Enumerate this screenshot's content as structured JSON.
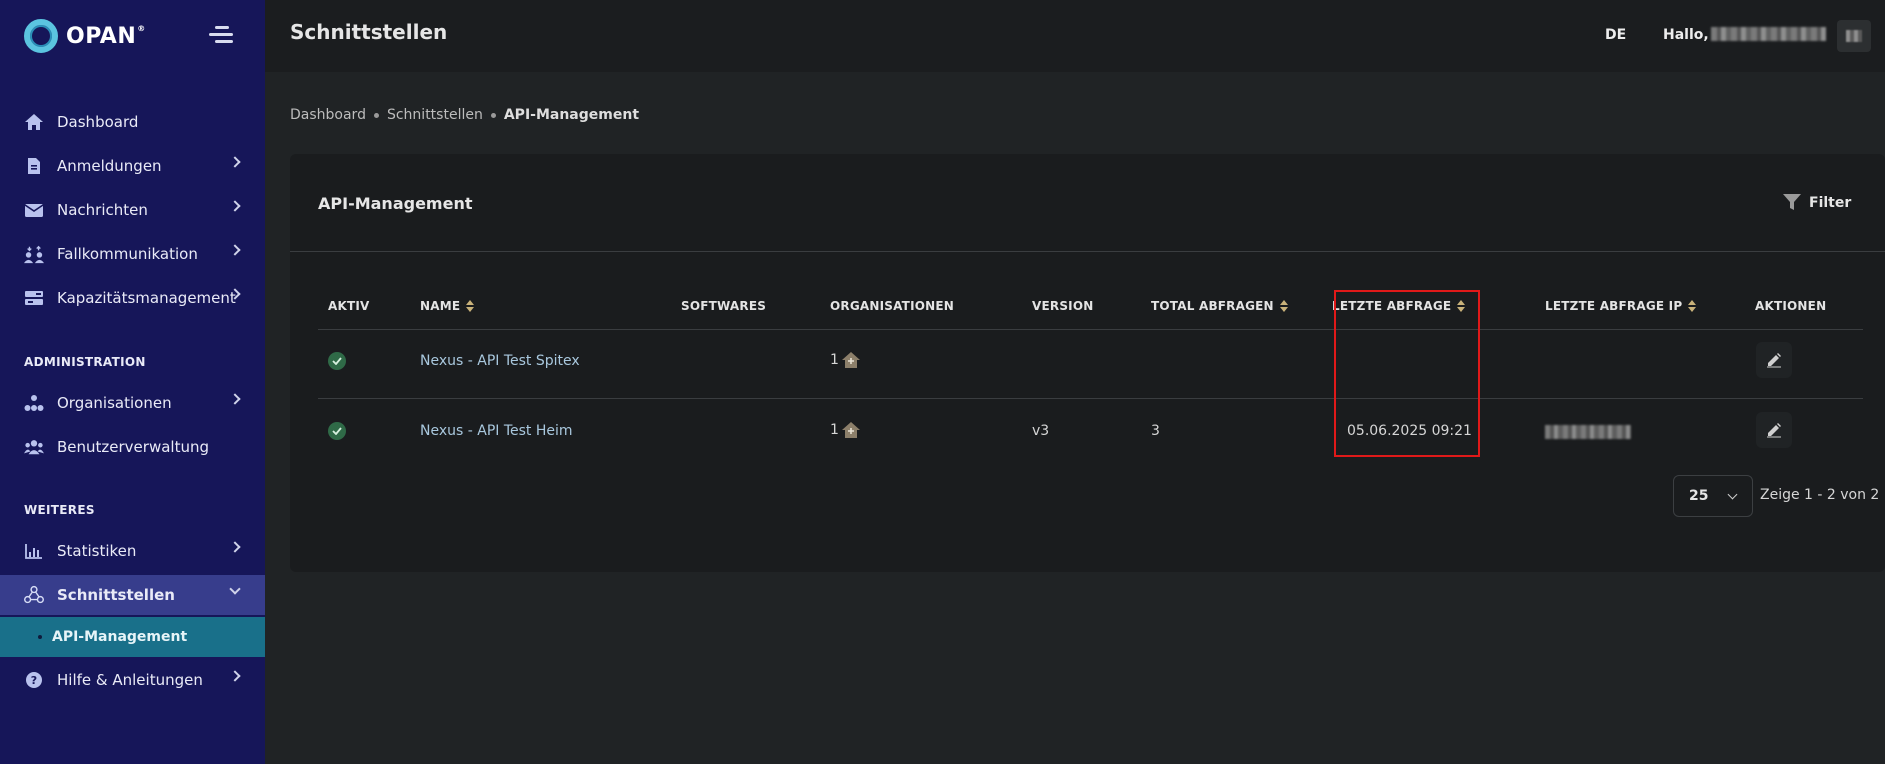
{
  "brand": {
    "name": "OPAN",
    "reg": "®"
  },
  "sidebar": {
    "items": [
      {
        "label": "Dashboard",
        "icon": "home-icon"
      },
      {
        "label": "Anmeldungen",
        "icon": "document-icon"
      },
      {
        "label": "Nachrichten",
        "icon": "mail-icon"
      },
      {
        "label": "Fallkommunikation",
        "icon": "people-exchange-icon"
      },
      {
        "label": "Kapazitätsmanagement",
        "icon": "capacity-icon"
      }
    ],
    "section_admin": "ADMINISTRATION",
    "admin_items": [
      {
        "label": "Organisationen",
        "icon": "org-chart-icon"
      },
      {
        "label": "Benutzerverwaltung",
        "icon": "users-icon"
      }
    ],
    "section_more": "WEITERES",
    "more_items": [
      {
        "label": "Statistiken",
        "icon": "stats-icon"
      },
      {
        "label": "Schnittstellen",
        "icon": "interfaces-icon"
      },
      {
        "label": "Hilfe & Anleitungen",
        "icon": "help-icon"
      }
    ],
    "sub_item": "API-Management"
  },
  "header": {
    "title": "Schnittstellen",
    "language": "DE",
    "greeting": "Hallo,"
  },
  "breadcrumb": [
    "Dashboard",
    "Schnittstellen",
    "API-Management"
  ],
  "card": {
    "title": "API-Management",
    "filter_label": "Filter"
  },
  "table": {
    "columns": [
      "AKTIV",
      "NAME",
      "SOFTWARES",
      "ORGANISATIONEN",
      "VERSION",
      "TOTAL ABFRAGEN",
      "LETZTE ABFRAGE",
      "LETZTE ABFRAGE IP",
      "AKTIONEN"
    ],
    "rows": [
      {
        "name": "Nexus - API Test Spitex",
        "softwares": "",
        "organisationen": "1",
        "version": "",
        "total": "",
        "letzte": ""
      },
      {
        "name": "Nexus - API Test Heim",
        "softwares": "",
        "organisationen": "1",
        "version": "v3",
        "total": "3",
        "letzte": "05.06.2025 09:21"
      }
    ]
  },
  "pagination": {
    "page_size": "25",
    "info": "Zeige 1 - 2 von 2"
  },
  "colors": {
    "sidebar": "#161659",
    "active_sub": "#19708a",
    "highlight": "#e01919"
  }
}
